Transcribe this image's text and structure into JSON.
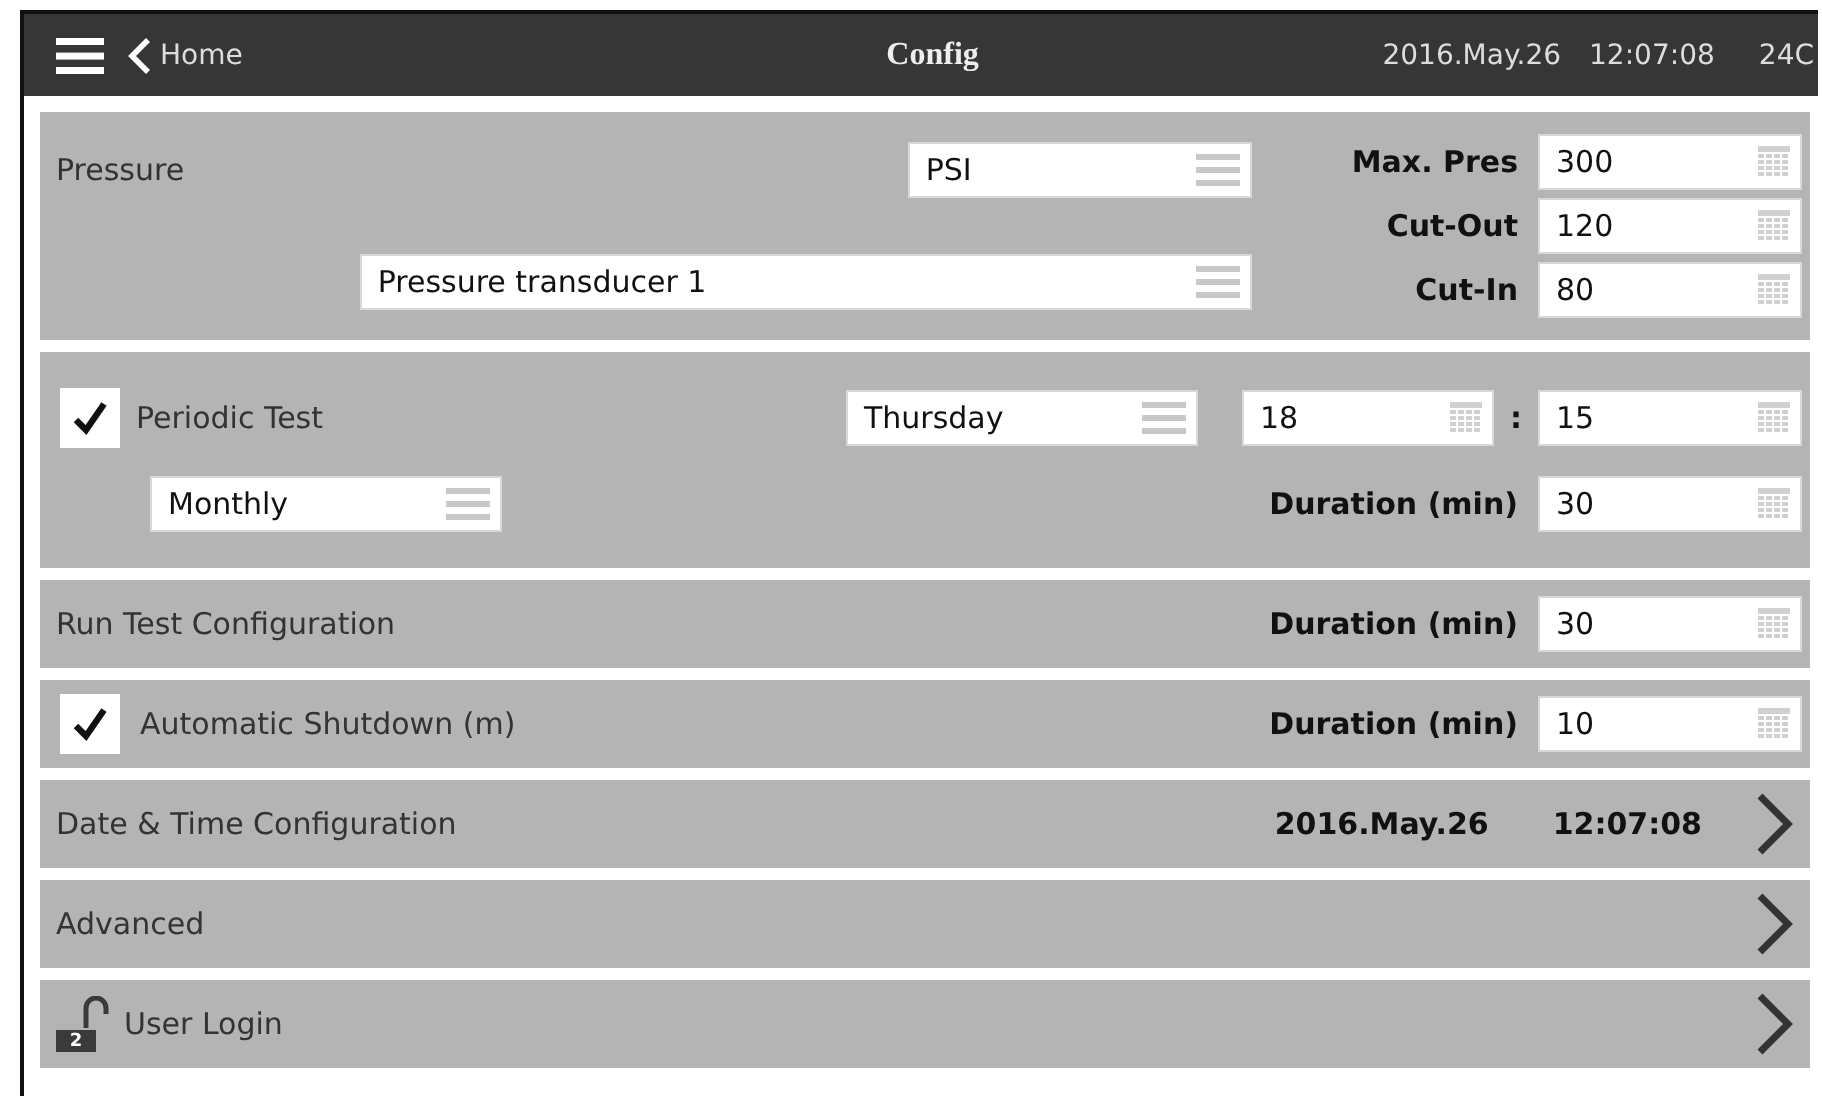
{
  "header": {
    "back_label": "Home",
    "title": "Config",
    "date": "2016.May.26",
    "time": "12:07:08",
    "temperature": "24C"
  },
  "pressure": {
    "title": "Pressure",
    "unit": "PSI",
    "sensor": "Pressure transducer 1",
    "settings": [
      {
        "label": "Max. Pres",
        "value": "300"
      },
      {
        "label": "Cut-Out",
        "value": "120"
      },
      {
        "label": "Cut-In",
        "value": "80"
      }
    ]
  },
  "periodic_test": {
    "checked": true,
    "label": "Periodic Test",
    "day": "Thursday",
    "hour": "18",
    "separator": ":",
    "minute": "15",
    "frequency": "Monthly",
    "duration_label": "Duration (min)",
    "duration": "30"
  },
  "run_test": {
    "label": "Run Test Configuration",
    "duration_label": "Duration (min)",
    "duration": "30"
  },
  "auto_shutdown": {
    "checked": true,
    "label": "Automatic Shutdown (m)",
    "duration_label": "Duration (min)",
    "duration": "10"
  },
  "nav_rows": [
    {
      "kind": "datetime",
      "label": "Date & Time Configuration",
      "date": "2016.May.26",
      "time": "12:07:08"
    },
    {
      "kind": "plain",
      "label": "Advanced"
    },
    {
      "kind": "login",
      "label": "User Login",
      "badge": "2"
    }
  ]
}
